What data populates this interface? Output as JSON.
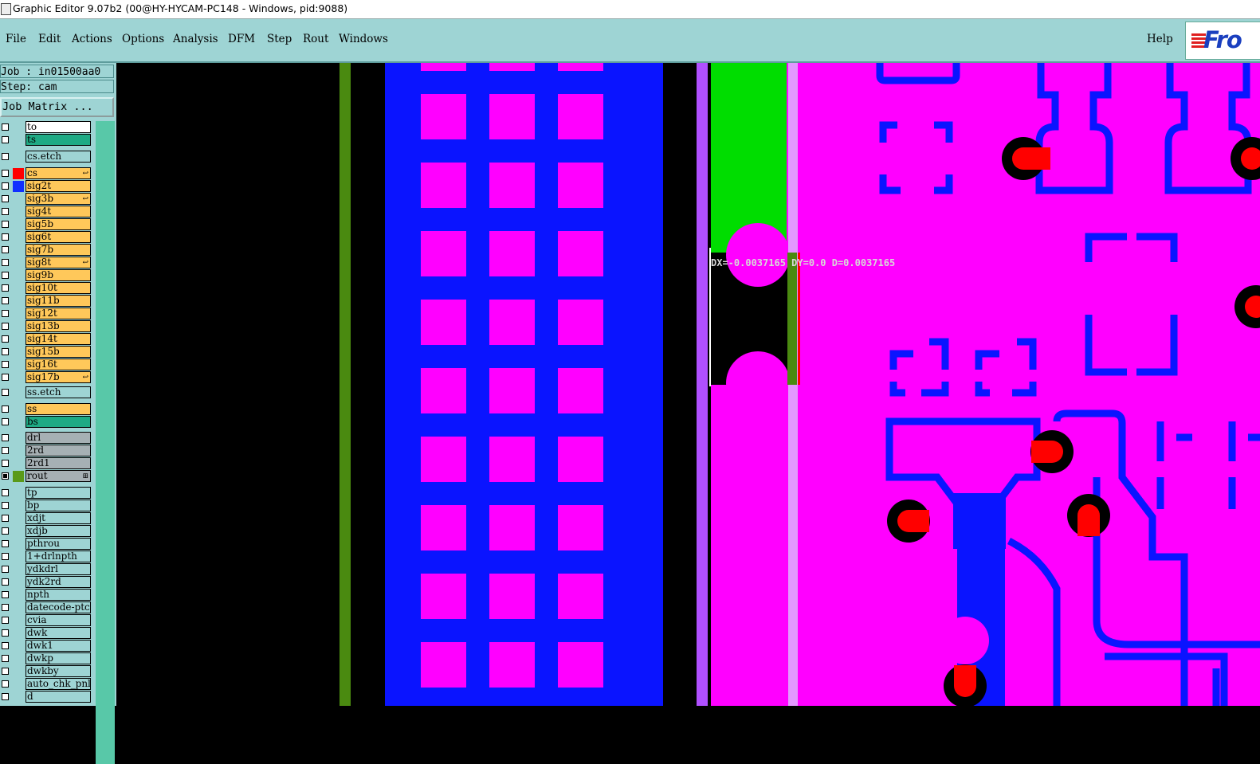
{
  "window": {
    "title": "Graphic Editor 9.07b2 (00@HY-HYCAM-PC148 - Windows, pid:9088)"
  },
  "menu": {
    "items": [
      "File",
      "Edit",
      "Actions",
      "Options",
      "Analysis",
      "DFM",
      "Step",
      "Rout",
      "Windows"
    ],
    "help": "Help"
  },
  "logo": {
    "text": "Fro"
  },
  "sidebar": {
    "job": "Job : in01500aa0",
    "step": "Step: cam",
    "matrix_button": "Job Matrix ..."
  },
  "layers": [
    {
      "name": "to",
      "kind": "white",
      "checked": false,
      "swatch": null,
      "mark": ""
    },
    {
      "name": "ts",
      "kind": "green",
      "checked": false,
      "swatch": null,
      "mark": ""
    },
    {
      "name": "cs.etch",
      "kind": "misc",
      "checked": false,
      "swatch": null,
      "mark": ""
    },
    {
      "name": "cs",
      "kind": "board",
      "checked": false,
      "swatch": "#ff0000",
      "mark": "↩"
    },
    {
      "name": "sig2t",
      "kind": "board",
      "checked": false,
      "swatch": "#1030ff",
      "mark": ""
    },
    {
      "name": "sig3b",
      "kind": "board",
      "checked": false,
      "swatch": null,
      "mark": "↩"
    },
    {
      "name": "sig4t",
      "kind": "board",
      "checked": false,
      "swatch": null,
      "mark": ""
    },
    {
      "name": "sig5b",
      "kind": "board",
      "checked": false,
      "swatch": null,
      "mark": ""
    },
    {
      "name": "sig6t",
      "kind": "board",
      "checked": false,
      "swatch": null,
      "mark": ""
    },
    {
      "name": "sig7b",
      "kind": "board",
      "checked": false,
      "swatch": null,
      "mark": ""
    },
    {
      "name": "sig8t",
      "kind": "board",
      "checked": false,
      "swatch": null,
      "mark": "↩"
    },
    {
      "name": "sig9b",
      "kind": "board",
      "checked": false,
      "swatch": null,
      "mark": ""
    },
    {
      "name": "sig10t",
      "kind": "board",
      "checked": false,
      "swatch": null,
      "mark": ""
    },
    {
      "name": "sig11b",
      "kind": "board",
      "checked": false,
      "swatch": null,
      "mark": ""
    },
    {
      "name": "sig12t",
      "kind": "board",
      "checked": false,
      "swatch": null,
      "mark": ""
    },
    {
      "name": "sig13b",
      "kind": "board",
      "checked": false,
      "swatch": null,
      "mark": ""
    },
    {
      "name": "sig14t",
      "kind": "board",
      "checked": false,
      "swatch": null,
      "mark": ""
    },
    {
      "name": "sig15b",
      "kind": "board",
      "checked": false,
      "swatch": null,
      "mark": ""
    },
    {
      "name": "sig16t",
      "kind": "board",
      "checked": false,
      "swatch": null,
      "mark": ""
    },
    {
      "name": "sig17b",
      "kind": "board",
      "checked": false,
      "swatch": null,
      "mark": "↩"
    },
    {
      "name": "ss.etch",
      "kind": "misc",
      "checked": false,
      "swatch": null,
      "mark": ""
    },
    {
      "name": "ss",
      "kind": "board",
      "checked": false,
      "swatch": null,
      "mark": ""
    },
    {
      "name": "bs",
      "kind": "green",
      "checked": false,
      "swatch": null,
      "mark": ""
    },
    {
      "name": "drl",
      "kind": "drill",
      "checked": false,
      "swatch": null,
      "mark": ""
    },
    {
      "name": "2rd",
      "kind": "drill",
      "checked": false,
      "swatch": null,
      "mark": ""
    },
    {
      "name": "2rd1",
      "kind": "drill",
      "checked": false,
      "swatch": null,
      "mark": ""
    },
    {
      "name": "rout",
      "kind": "drill",
      "checked": true,
      "swatch": "#5a9a1a",
      "mark": "⊞"
    },
    {
      "name": "tp",
      "kind": "misc",
      "checked": false,
      "swatch": null,
      "mark": ""
    },
    {
      "name": "bp",
      "kind": "misc",
      "checked": false,
      "swatch": null,
      "mark": ""
    },
    {
      "name": "xdjt",
      "kind": "misc",
      "checked": false,
      "swatch": null,
      "mark": ""
    },
    {
      "name": "xdjb",
      "kind": "misc",
      "checked": false,
      "swatch": null,
      "mark": ""
    },
    {
      "name": "pthrou",
      "kind": "misc",
      "checked": false,
      "swatch": null,
      "mark": ""
    },
    {
      "name": "1+drlnpth",
      "kind": "misc",
      "checked": false,
      "swatch": null,
      "mark": ""
    },
    {
      "name": "ydkdrl",
      "kind": "misc",
      "checked": false,
      "swatch": null,
      "mark": ""
    },
    {
      "name": "ydk2rd",
      "kind": "misc",
      "checked": false,
      "swatch": null,
      "mark": ""
    },
    {
      "name": "npth",
      "kind": "misc",
      "checked": false,
      "swatch": null,
      "mark": ""
    },
    {
      "name": "datecode-ptc",
      "kind": "misc",
      "checked": false,
      "swatch": null,
      "mark": ""
    },
    {
      "name": "cvia",
      "kind": "misc",
      "checked": false,
      "swatch": null,
      "mark": ""
    },
    {
      "name": "dwk",
      "kind": "misc",
      "checked": false,
      "swatch": null,
      "mark": ""
    },
    {
      "name": "dwk1",
      "kind": "misc",
      "checked": false,
      "swatch": null,
      "mark": ""
    },
    {
      "name": "dwkp",
      "kind": "misc",
      "checked": false,
      "swatch": null,
      "mark": ""
    },
    {
      "name": "dwkby",
      "kind": "misc",
      "checked": false,
      "swatch": null,
      "mark": ""
    },
    {
      "name": "auto_chk_pnl",
      "kind": "misc",
      "checked": false,
      "swatch": null,
      "mark": ""
    },
    {
      "name": "d",
      "kind": "misc",
      "checked": false,
      "swatch": null,
      "mark": ""
    }
  ],
  "canvas": {
    "measure_readout": "DX=-0.0037165 DY=0.0 D=0.0037165",
    "colors": {
      "background": "#000000",
      "magenta": "#ff00ff",
      "blue": "#0a14ff",
      "red": "#ff0000",
      "green": "#00dd00",
      "rout": "#4a8a10",
      "purple": "#b050ff"
    }
  }
}
